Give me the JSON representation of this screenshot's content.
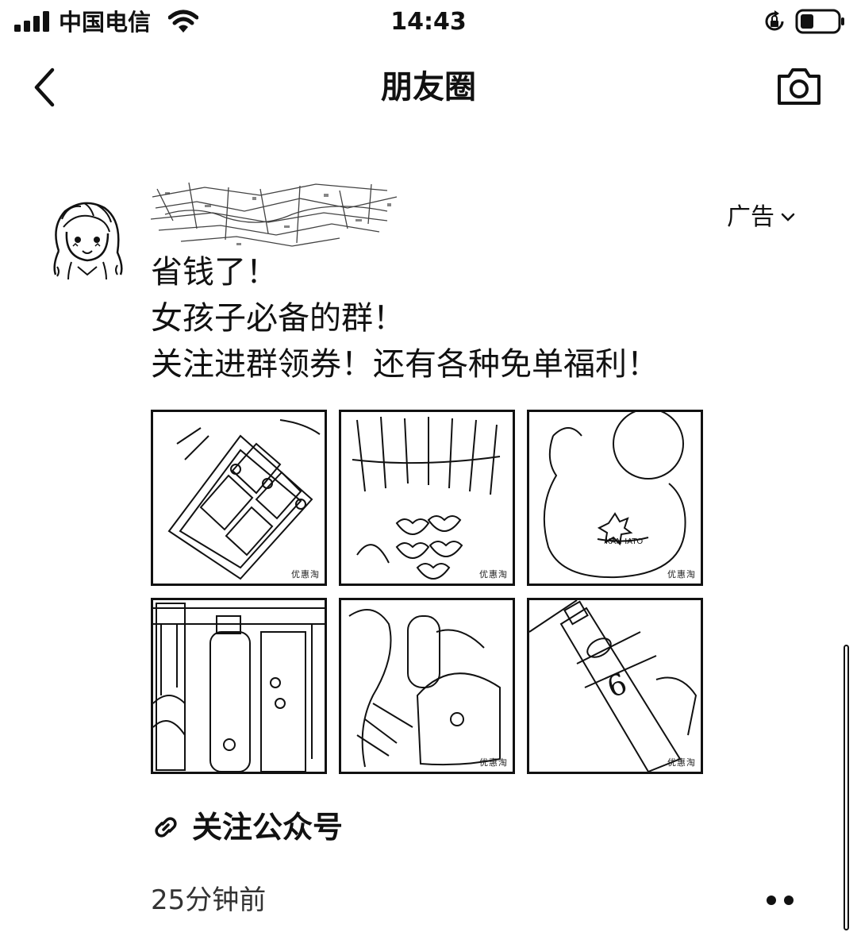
{
  "status_bar": {
    "carrier": "中国电信",
    "time": "14:43",
    "icons": [
      "signal-icon",
      "wifi-icon",
      "rotation-lock-icon",
      "battery-icon"
    ]
  },
  "nav": {
    "title": "朋友圈",
    "back_icon": "chevron-left-icon",
    "camera_icon": "camera-icon"
  },
  "post": {
    "ad_label": "广告",
    "text_lines": [
      "省钱了！",
      "女孩子必备的群！",
      "关注进群领券！还有各种免单福利！"
    ],
    "photos": [
      {
        "subject": "eyeshadow-palette",
        "watermark": "优惠淘"
      },
      {
        "subject": "lip-swatches",
        "watermark": "优惠淘"
      },
      {
        "subject": "bear-shaped-bottle",
        "watermark": "优惠淘"
      },
      {
        "subject": "skincare-bottles",
        "watermark": ""
      },
      {
        "subject": "skincare-product",
        "watermark": "优惠淘"
      },
      {
        "subject": "number-6-bottle",
        "watermark": "优惠淘"
      }
    ],
    "link_label": "关注公众号",
    "time_ago": "25分钟前"
  }
}
